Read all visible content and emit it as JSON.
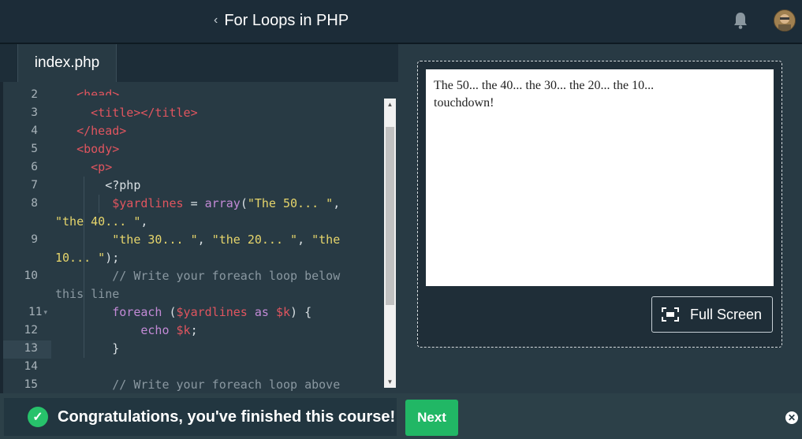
{
  "header": {
    "back_icon": "chevron-left",
    "title": "For Loops in PHP",
    "notification_icon": "bell-icon",
    "avatar_icon": "user-avatar"
  },
  "tabs": [
    {
      "label": "index.php",
      "active": true
    }
  ],
  "editor": {
    "line_numbers": [
      "2",
      "3",
      "4",
      "5",
      "6",
      "7",
      "8",
      "",
      "9",
      "",
      "10",
      "",
      "11",
      "12",
      "13",
      "14",
      "15"
    ],
    "active_line": "13"
  },
  "preview": {
    "output_text": "The 50... the 40... the 30... the 20... the 10... touchdown!",
    "fullscreen_label": "Full Screen"
  },
  "footer": {
    "message": "Congratulations, you've finished this course!",
    "next_label": "Next",
    "close_icon": "close-icon"
  },
  "colors": {
    "accent_green": "#21b765",
    "header_bg": "#1c2c38",
    "editor_bg": "#283a44"
  }
}
